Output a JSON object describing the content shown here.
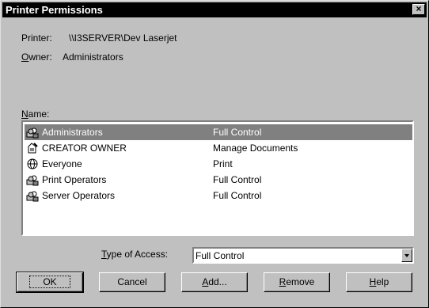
{
  "window": {
    "title": "Printer Permissions",
    "close_glyph": "×"
  },
  "printer": {
    "label": "Printer:",
    "value": "\\\\I3SERVER\\Dev Laserjet"
  },
  "owner": {
    "label_prefix": "O",
    "label_rest": "wner:",
    "value": "Administrators"
  },
  "name_label": {
    "prefix": "N",
    "rest": "ame:"
  },
  "list": {
    "rows": [
      {
        "name": "Administrators",
        "access": "Full Control",
        "icon": "group-icon"
      },
      {
        "name": "CREATOR OWNER",
        "access": "Manage Documents",
        "icon": "creator-owner-icon"
      },
      {
        "name": "Everyone",
        "access": "Print",
        "icon": "globe-icon"
      },
      {
        "name": "Print Operators",
        "access": "Full Control",
        "icon": "group-icon"
      },
      {
        "name": "Server Operators",
        "access": "Full Control",
        "icon": "group-icon"
      }
    ]
  },
  "type_of_access": {
    "label_prefix": "T",
    "label_rest": "ype of Access:",
    "value": "Full Control"
  },
  "buttons": {
    "ok": "OK",
    "cancel": "Cancel",
    "add_prefix": "A",
    "add_rest": "dd...",
    "remove_prefix": "R",
    "remove_rest": "emove",
    "help_prefix": "H",
    "help_rest": "elp"
  },
  "colors": {
    "face": "#c0c0c0",
    "selection": "#808080",
    "titlebar": "#000000"
  }
}
